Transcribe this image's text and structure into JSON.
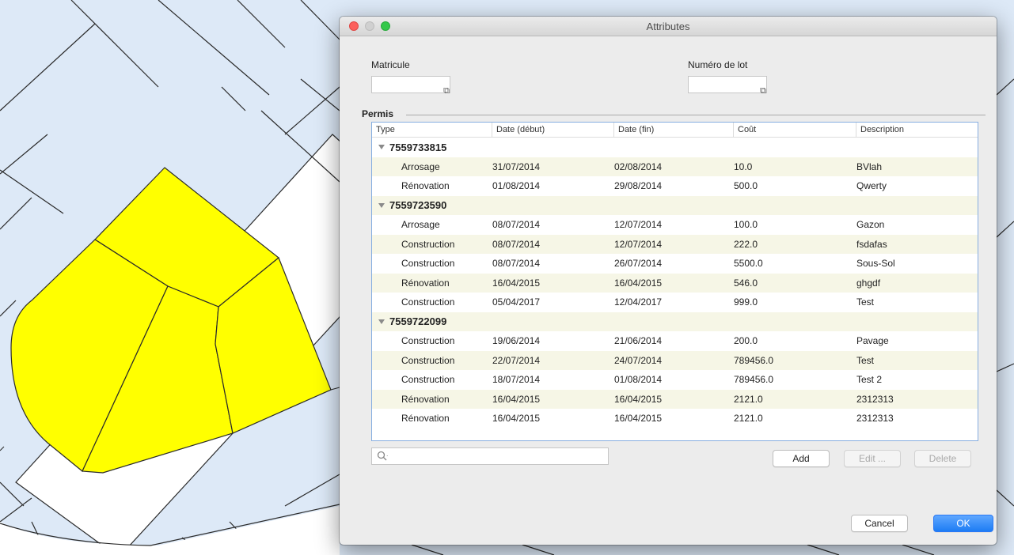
{
  "window": {
    "title": "Attributes"
  },
  "fields": {
    "matricule": {
      "label": "Matricule",
      "value": ""
    },
    "numero_lot": {
      "label": "Numéro de lot",
      "value": ""
    }
  },
  "section": {
    "title": "Permis"
  },
  "table": {
    "columns": [
      "Type",
      "Date (début)",
      "Date (fin)",
      "Coût",
      "Description"
    ],
    "groups": [
      {
        "id": "7559733815",
        "rows": [
          [
            "Arrosage",
            "31/07/2014",
            "02/08/2014",
            "10.0",
            "BVlah"
          ],
          [
            "Rénovation",
            "01/08/2014",
            "29/08/2014",
            "500.0",
            "Qwerty"
          ]
        ]
      },
      {
        "id": "7559723590",
        "rows": [
          [
            "Arrosage",
            "08/07/2014",
            "12/07/2014",
            "100.0",
            "Gazon"
          ],
          [
            "Construction",
            "08/07/2014",
            "12/07/2014",
            "222.0",
            "fsdafas"
          ],
          [
            "Construction",
            "08/07/2014",
            "26/07/2014",
            "5500.0",
            "Sous-Sol"
          ],
          [
            "Rénovation",
            "16/04/2015",
            "16/04/2015",
            "546.0",
            "ghgdf"
          ],
          [
            "Construction",
            "05/04/2017",
            "12/04/2017",
            "999.0",
            "Test"
          ]
        ]
      },
      {
        "id": "7559722099",
        "rows": [
          [
            "Construction",
            "19/06/2014",
            "21/06/2014",
            "200.0",
            "Pavage"
          ],
          [
            "Construction",
            "22/07/2014",
            "24/07/2014",
            "789456.0",
            "Test"
          ],
          [
            "Construction",
            "18/07/2014",
            "01/08/2014",
            "789456.0",
            "Test 2"
          ],
          [
            "Rénovation",
            "16/04/2015",
            "16/04/2015",
            "2121.0",
            "2312313"
          ],
          [
            "Rénovation",
            "16/04/2015",
            "16/04/2015",
            "2121.0",
            "2312313"
          ]
        ]
      }
    ]
  },
  "search": {
    "placeholder": ""
  },
  "buttons": {
    "add": "Add",
    "edit": "Edit ...",
    "delete": "Delete",
    "cancel": "Cancel",
    "ok": "OK"
  },
  "colors": {
    "selected_parcels": "#ffff00",
    "map_background": "#dde9f7",
    "accent": "#1d7cf4"
  }
}
